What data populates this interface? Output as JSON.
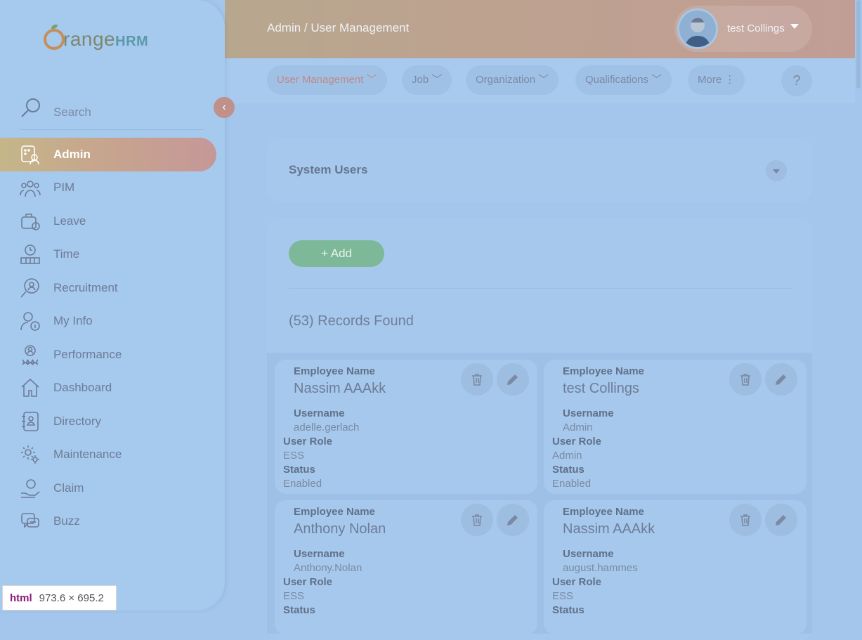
{
  "brand": {
    "logo_main": "range",
    "logo_hrm": "HRM"
  },
  "sidebar": {
    "search_label": "Search",
    "collapse_icon": "chevron-left-icon",
    "items": [
      {
        "label": "Admin",
        "icon": "admin-icon",
        "active": true
      },
      {
        "label": "PIM",
        "icon": "pim-icon"
      },
      {
        "label": "Leave",
        "icon": "leave-icon"
      },
      {
        "label": "Time",
        "icon": "time-icon"
      },
      {
        "label": "Recruitment",
        "icon": "recruitment-icon"
      },
      {
        "label": "My Info",
        "icon": "my-info-icon"
      },
      {
        "label": "Performance",
        "icon": "performance-icon"
      },
      {
        "label": "Dashboard",
        "icon": "dashboard-icon"
      },
      {
        "label": "Directory",
        "icon": "directory-icon"
      },
      {
        "label": "Maintenance",
        "icon": "maintenance-icon"
      },
      {
        "label": "Claim",
        "icon": "claim-icon"
      },
      {
        "label": "Buzz",
        "icon": "buzz-icon"
      }
    ]
  },
  "header": {
    "breadcrumb": "Admin / User Management",
    "user_name": "test Collings"
  },
  "subnav": {
    "tabs": [
      "User Management",
      "Job",
      "Organization",
      "Qualifications",
      "More"
    ],
    "help": "?"
  },
  "filter": {
    "title": "System Users"
  },
  "records": {
    "add_label": "+ Add",
    "found_text": "(53) Records Found",
    "labels": {
      "employee_name": "Employee Name",
      "username": "Username",
      "user_role": "User Role",
      "status": "Status"
    },
    "items": [
      {
        "employee_name": "Nassim AAAkk",
        "username": "adelle.gerlach",
        "user_role": "ESS",
        "status": "Enabled"
      },
      {
        "employee_name": "test Collings",
        "username": "Admin",
        "user_role": "Admin",
        "status": "Enabled"
      },
      {
        "employee_name": "Anthony Nolan",
        "username": "Anthony.Nolan",
        "user_role": "ESS",
        "status": ""
      },
      {
        "employee_name": "Nassim AAAkk",
        "username": "august.hammes",
        "user_role": "ESS",
        "status": ""
      }
    ]
  },
  "devtools": {
    "tag": "html",
    "size": "973.6 × 695.2"
  },
  "colors": {
    "accent": "#c59898",
    "add_button": "#7db898",
    "background": "#a4c6ec"
  }
}
